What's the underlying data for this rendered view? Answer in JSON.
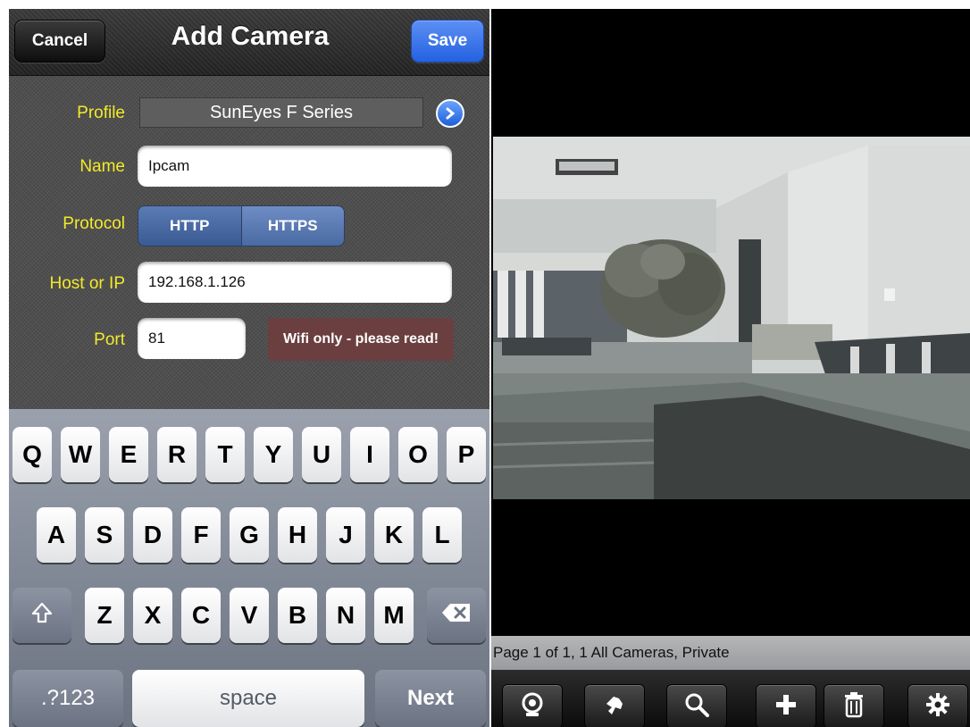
{
  "left_screen": {
    "navbar": {
      "title": "Add Camera",
      "cancel_label": "Cancel",
      "save_label": "Save"
    },
    "form": {
      "profile_label": "Profile",
      "profile_value": "SunEyes F Series",
      "name_label": "Name",
      "name_value": "Ipcam",
      "protocol_label": "Protocol",
      "protocol_options": [
        "HTTP",
        "HTTPS"
      ],
      "protocol_selected": "HTTP",
      "host_label": "Host or IP",
      "host_value": "192.168.1.126",
      "port_label": "Port",
      "port_value": "81",
      "wifi_note": "Wifi only - please read!"
    },
    "keyboard": {
      "row1": [
        "Q",
        "W",
        "E",
        "R",
        "T",
        "Y",
        "U",
        "I",
        "O",
        "P"
      ],
      "row2": [
        "A",
        "S",
        "D",
        "F",
        "G",
        "H",
        "J",
        "K",
        "L"
      ],
      "row3": [
        "Z",
        "X",
        "C",
        "V",
        "B",
        "N",
        "M"
      ],
      "shift_icon": "shift-arrow-icon",
      "delete_icon": "backspace-icon",
      "numbers_label": ".?123",
      "space_label": "space",
      "next_label": "Next"
    }
  },
  "right_screen": {
    "camera_feed": "office-room-view",
    "status_text": "Page 1 of 1, 1 All Cameras, Private",
    "toolbar_icons": [
      "webcam-icon",
      "pan-hand-icon",
      "search-icon",
      "plus-icon",
      "trash-icon",
      "gear-icon"
    ]
  },
  "colors": {
    "label_yellow": "#f2ea2a",
    "save_blue": "#2f6ce6",
    "segment_blue": "#4a6aa3",
    "wifi_note_red": "#6b3f3f"
  }
}
